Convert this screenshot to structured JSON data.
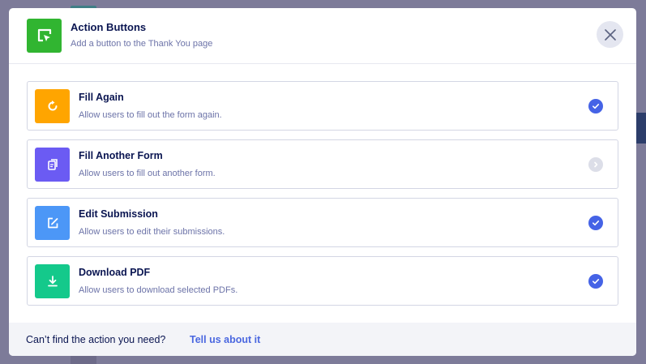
{
  "modal": {
    "title": "Action Buttons",
    "subtitle": "Add a button to the Thank You page",
    "header_icon": "cursor-frame-icon",
    "accent": "#31b531"
  },
  "actions": [
    {
      "title": "Fill Again",
      "description": "Allow users to fill out the form again.",
      "icon": "refresh-icon",
      "color": "#ffa500",
      "checked": true
    },
    {
      "title": "Fill Another Form",
      "description": "Allow users to fill out another form.",
      "icon": "forms-icon",
      "color": "#6b5bf3",
      "checked": false
    },
    {
      "title": "Edit Submission",
      "description": "Allow users to edit their submissions.",
      "icon": "edit-icon",
      "color": "#4c97f7",
      "checked": true
    },
    {
      "title": "Download PDF",
      "description": "Allow users to download selected PDFs.",
      "icon": "download-icon",
      "color": "#14c98b",
      "checked": true
    }
  ],
  "footer": {
    "text": "Can’t find the action you need?",
    "link": "Tell us about it"
  },
  "colors": {
    "checked": "#4563e6",
    "unchecked": "#dcdee8",
    "link": "#4a67e0"
  }
}
